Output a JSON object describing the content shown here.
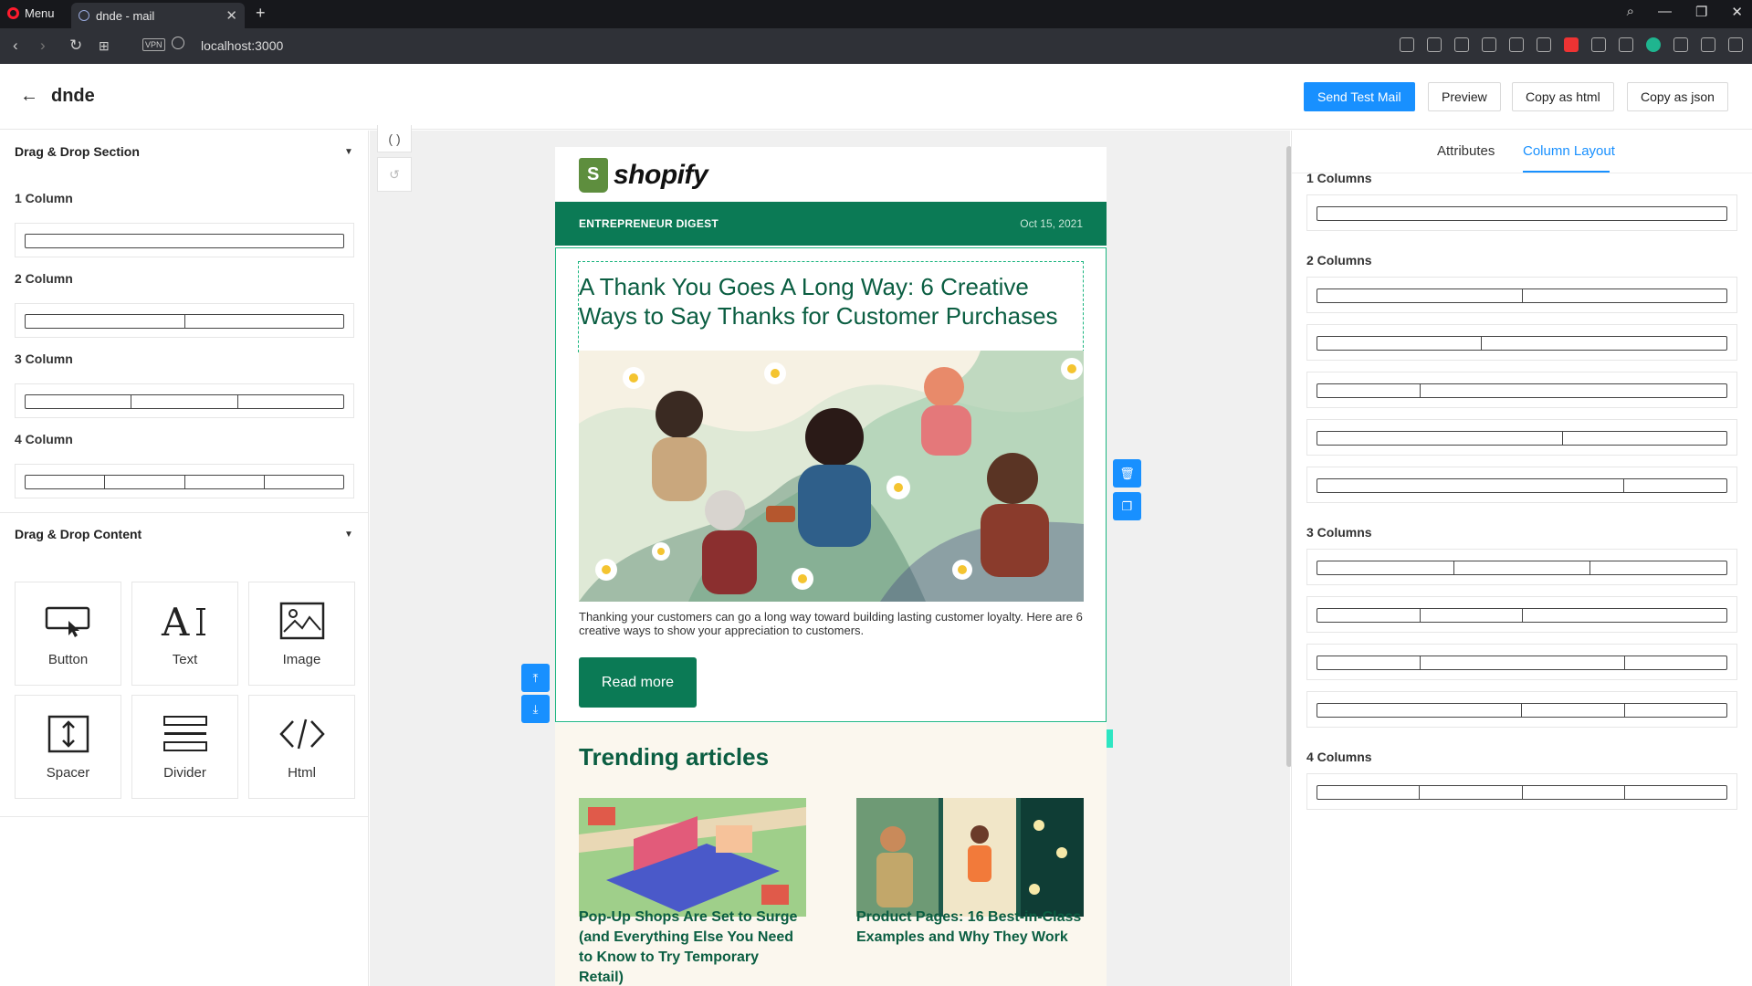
{
  "browser": {
    "menu_label": "Menu",
    "tab_title": "dnde - mail",
    "url": "localhost:3000",
    "vpn_label": "VPN"
  },
  "app": {
    "title": "dnde",
    "buttons": {
      "send_test": "Send Test Mail",
      "preview": "Preview",
      "copy_html": "Copy as html",
      "copy_json": "Copy as json"
    }
  },
  "left_panel": {
    "section_title": "Drag & Drop Section",
    "columns": [
      {
        "label": "1 Column",
        "count": 1
      },
      {
        "label": "2 Column",
        "count": 2
      },
      {
        "label": "3 Column",
        "count": 3
      },
      {
        "label": "4 Column",
        "count": 4
      }
    ],
    "content_title": "Drag & Drop Content",
    "content_items": [
      {
        "label": "Button",
        "icon": "button-icon"
      },
      {
        "label": "Text",
        "icon": "text-icon"
      },
      {
        "label": "Image",
        "icon": "image-icon"
      },
      {
        "label": "Spacer",
        "icon": "spacer-icon"
      },
      {
        "label": "Divider",
        "icon": "divider-icon"
      },
      {
        "label": "Html",
        "icon": "html-code-icon"
      }
    ]
  },
  "email": {
    "brand": "shopify",
    "banner_title": "ENTREPRENEUR DIGEST",
    "banner_date": "Oct 15, 2021",
    "headline": "A Thank You Goes A Long Way: 6 Creative Ways to Say Thanks for Customer Purchases",
    "description": "Thanking your customers can go a long way toward building lasting customer loyalty. Here are 6 creative ways to show your appreciation to customers.",
    "read_more": "Read more",
    "row_tag": "row",
    "trending_title": "Trending articles",
    "articles": [
      {
        "title": "Pop-Up Shops Are Set to Surge (and Everything Else You Need to Know to Try Temporary Retail)"
      },
      {
        "title": "Product Pages: 16 Best-in-Class Examples and Why They Work"
      }
    ]
  },
  "right_panel": {
    "tabs": [
      "Attributes",
      "Column Layout"
    ],
    "active_tab": "Column Layout",
    "groups": [
      {
        "label": "1 Columns",
        "layouts": [
          [
            1
          ]
        ]
      },
      {
        "label": "2 Columns",
        "layouts": [
          [
            50,
            50
          ],
          [
            40,
            60
          ],
          [
            25,
            75
          ],
          [
            60,
            40
          ],
          [
            75,
            25
          ]
        ]
      },
      {
        "label": "3 Columns",
        "layouts": [
          [
            33.3,
            33.3,
            33.4
          ],
          [
            25,
            25,
            50
          ],
          [
            25,
            50,
            25
          ],
          [
            50,
            25,
            25
          ]
        ]
      },
      {
        "label": "4 Columns",
        "layouts": [
          [
            25,
            25,
            25,
            25
          ]
        ]
      }
    ]
  },
  "colors": {
    "accent": "#1890ff",
    "brand_green": "#0b7a55",
    "headline_green": "#0b5e42"
  }
}
